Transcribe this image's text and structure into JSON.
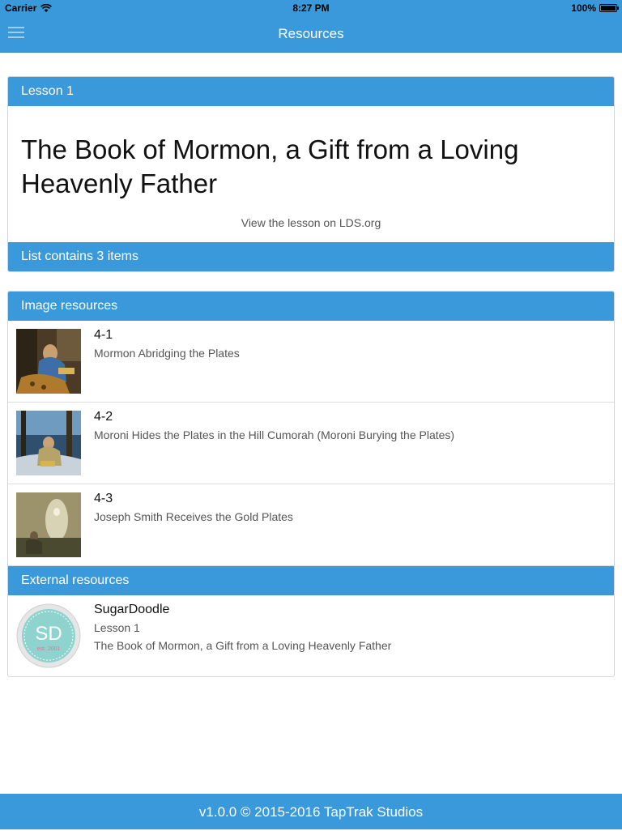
{
  "status_bar": {
    "carrier": "Carrier",
    "time": "8:27 PM",
    "battery": "100%"
  },
  "nav": {
    "title": "Resources",
    "menu_icon": "hamburger-menu-icon"
  },
  "lesson_card": {
    "header": "Lesson 1",
    "title": "The Book of Mormon, a Gift from a Loving Heavenly Father",
    "link": "View the lesson on LDS.org",
    "list_footer": "List contains 3 items"
  },
  "image_resources": {
    "header": "Image resources",
    "items": [
      {
        "name": "4-1",
        "description": "Mormon Abridging the Plates"
      },
      {
        "name": "4-2",
        "description": "Moroni Hides the Plates in the Hill Cumorah (Moroni Burying the Plates)"
      },
      {
        "name": "4-3",
        "description": "Joseph Smith Receives the Gold Plates"
      }
    ]
  },
  "external_resources": {
    "header": "External resources",
    "items": [
      {
        "name": "SugarDoodle",
        "line1": "Lesson 1",
        "line2": "The Book of Mormon, a Gift from a Loving Heavenly Father",
        "logo_text": "SD",
        "logo_subtext": "est. 2001"
      }
    ]
  },
  "footer": {
    "text": "v1.0.0 © 2015-2016 TapTrak Studios"
  },
  "colors": {
    "accent": "#3a99da"
  }
}
